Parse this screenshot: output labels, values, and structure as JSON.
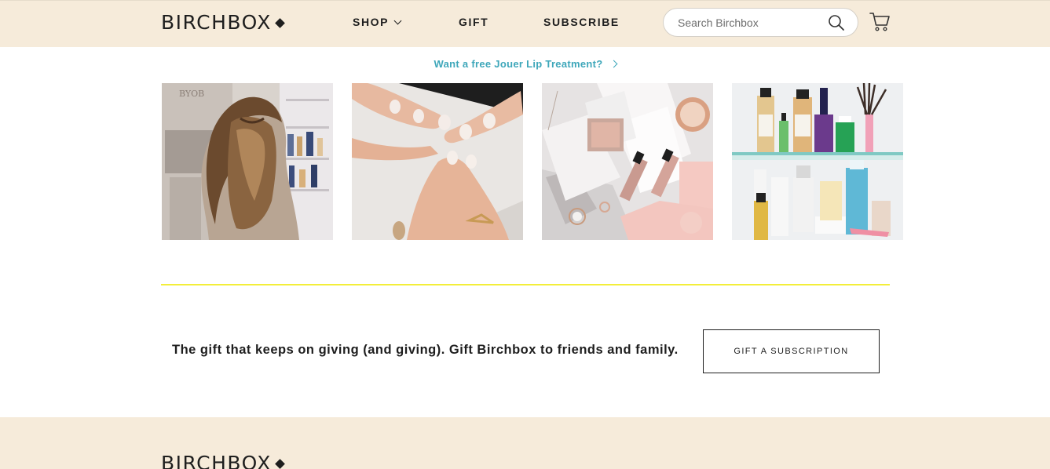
{
  "header": {
    "logo": "BIRCHBOX",
    "nav": {
      "shop": "SHOP",
      "gift": "GIFT",
      "subscribe": "SUBSCRIBE"
    },
    "search": {
      "placeholder": "Search Birchbox",
      "value": ""
    }
  },
  "promo": {
    "text": "Want a free Jouer Lip Treatment?"
  },
  "gallery": {
    "tiles": [
      {
        "subject": "hair-photo"
      },
      {
        "subject": "nails-photo"
      },
      {
        "subject": "makeup-photo"
      },
      {
        "subject": "skincare-photo"
      }
    ]
  },
  "gift_banner": {
    "text": "The gift that keeps on giving (and giving). Gift Birchbox to friends and family.",
    "button_label": "GIFT A SUBSCRIPTION"
  },
  "footer": {
    "logo": "BIRCHBOX"
  },
  "colors": {
    "header_bg": "#f6ebda",
    "accent_link": "#3ea7ba",
    "divider": "#f3ee3a",
    "text": "#1e1e1e"
  }
}
